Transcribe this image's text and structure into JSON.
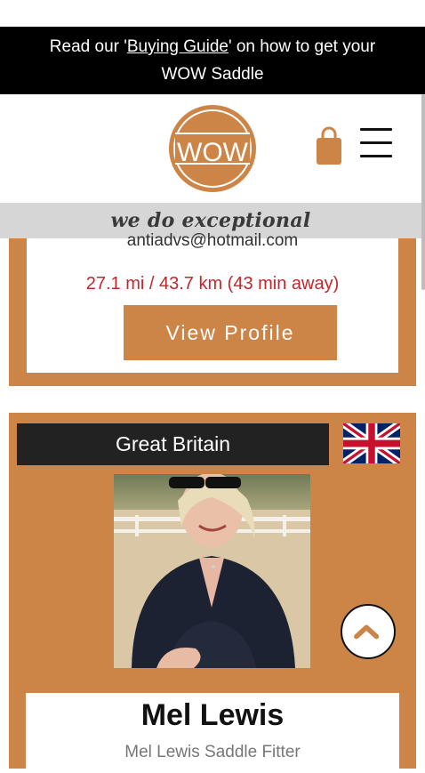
{
  "promo": {
    "prefix": "Read our '",
    "link_text": "Buying Guide",
    "middle": "' on how to get your",
    "second_line": "WOW Saddle"
  },
  "header": {
    "logo_text": "WOW",
    "tagline": "we do exceptional"
  },
  "fitter_card_top": {
    "email": "antiadvs@hotmail.com",
    "distance": "27.1 mi / 43.7 km (43 min away)",
    "button_label": "View Profile"
  },
  "fitter_card": {
    "country": "Great Britain",
    "name": "Mel Lewis",
    "subtitle": "Mel Lewis Saddle Fitter"
  },
  "colors": {
    "brand": "#cd8447",
    "distance": "#c1272d",
    "promo_bg": "#000000"
  },
  "icons": [
    "wow-logo",
    "shopping-bag-icon",
    "hamburger-menu-icon",
    "union-jack-flag-icon",
    "chevron-up-icon"
  ]
}
